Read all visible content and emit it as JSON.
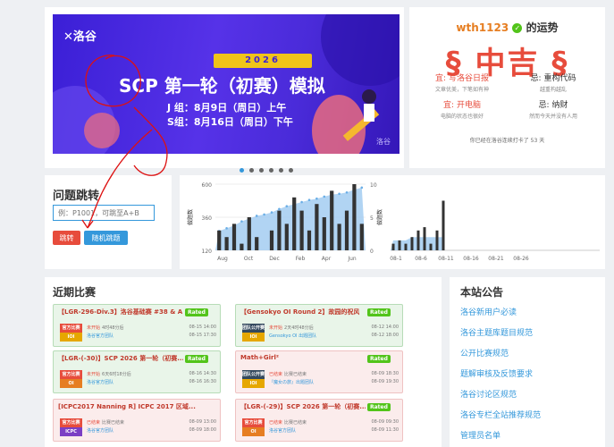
{
  "banner": {
    "logo": "洛谷",
    "year": "2026",
    "title": "SCP 第一轮（初赛）模拟",
    "line_j": "J 组：8月9日（周日）上午",
    "line_s": "S组：8月16日（周日）下午",
    "corner": "洛谷",
    "slide_count": 6,
    "active_slide": 0
  },
  "fortune": {
    "username": "wth1123",
    "suffix": "的运势",
    "result": "§ 中吉 §",
    "good_label": "宜:",
    "bad_label": "忌:",
    "good": [
      {
        "text": "写洛谷日报",
        "sub": "文章优美，下笔如有神"
      },
      {
        "text": "开电脑",
        "sub": "电脑的状态也很好"
      }
    ],
    "bad": [
      {
        "text": "重构代码",
        "sub": "越重构越乱"
      },
      {
        "text": "纳财",
        "sub": "然而今天并没有人用"
      }
    ],
    "footer": "你已经在洛谷连续打卡了 53 天"
  },
  "jump": {
    "title": "问题跳转",
    "placeholder": "例：P1001，可跳至A+B",
    "jump_label": "跳转",
    "random_label": "随机跳题"
  },
  "chart_data": [
    {
      "type": "bar",
      "ylabel": "做题数",
      "y2label": "做题数",
      "yticks": [
        120,
        360,
        600
      ],
      "y2ticks": [
        0,
        5,
        10
      ],
      "xticks": [
        "Aug",
        "Oct",
        "Dec",
        "Feb",
        "Apr",
        "Jun"
      ],
      "area": [
        260,
        280,
        300,
        330,
        350,
        370,
        380,
        395,
        420,
        440,
        455,
        470,
        485,
        495,
        510,
        525,
        530,
        540,
        560,
        575
      ],
      "bars": [
        3,
        2,
        4,
        1,
        5,
        2,
        0,
        3,
        6,
        4,
        8,
        6,
        3,
        7,
        5,
        9,
        4,
        6,
        10,
        4
      ]
    },
    {
      "type": "bar",
      "xticks": [
        "08-1",
        "08-6",
        "08-11",
        "08-16",
        "08-21",
        "08-26"
      ],
      "area": [
        1.5,
        1.5,
        1.5,
        2,
        2,
        2,
        2,
        2,
        2
      ],
      "bars": [
        1,
        1.5,
        1,
        2,
        3,
        3.5,
        1,
        3,
        7.5
      ]
    }
  ],
  "contests": {
    "title": "近期比赛",
    "items": [
      {
        "name": "【LGR-296-Div.3】洛谷基础赛 #38 & A...",
        "rated": "Rated",
        "type": "官方比赛",
        "rule": "IOI",
        "status": "未开始",
        "status_detail": "4时48分后",
        "host": "洛谷官方团队",
        "start": "08-15 14:00",
        "end": "08-15 17:30",
        "color": "green",
        "type_color": "red",
        "rule_color": "yellow"
      },
      {
        "name": "【Gensokyo OI Round 2】故园的祝风",
        "rated": "Rated",
        "type": "团队公开赛",
        "rule": "IOI",
        "status": "未开始",
        "status_detail": "2天4时48分后",
        "host": "Gensokyo OI 出题团队",
        "start": "08-12 14:00",
        "end": "08-12 18:00",
        "color": "green",
        "type_color": "dark",
        "rule_color": "yellow"
      },
      {
        "name": "【LGR-(-30)】SCP 2026 第一轮（初赛...",
        "rated": "Rated",
        "type": "官方比赛",
        "rule": "OI",
        "status": "未开始",
        "status_detail": "6天6时18分后",
        "host": "洛谷官方团队",
        "start": "08-16 14:30",
        "end": "08-16 16:30",
        "color": "green",
        "type_color": "red",
        "rule_color": "orange"
      },
      {
        "name": "Math+Girl²",
        "rated": "Rated",
        "type": "团队公开赛",
        "rule": "IOI",
        "status": "已结束",
        "status_detail": "比赛已结束",
        "host": "『魔女の旅』出题团队",
        "start": "08-09 18:30",
        "end": "08-09 19:30",
        "color": "red",
        "type_color": "dark",
        "rule_color": "yellow"
      },
      {
        "name": "[ICPC2017 Nanning R] ICPC 2017 区域...",
        "rated": "",
        "type": "官方比赛",
        "rule": "ICPC",
        "status": "已结束",
        "status_detail": "比赛已结束",
        "host": "洛谷官方团队",
        "start": "08-09 13:00",
        "end": "08-09 18:00",
        "color": "red",
        "type_color": "red",
        "rule_color": "purple"
      },
      {
        "name": "【LGR-(-29)】SCP 2026 第一轮（初赛...",
        "rated": "Rated",
        "type": "官方比赛",
        "rule": "OI",
        "status": "已结束",
        "status_detail": "比赛已结束",
        "host": "洛谷官方团队",
        "start": "08-09 09:30",
        "end": "08-09 11:30",
        "color": "red",
        "type_color": "red",
        "rule_color": "orange"
      }
    ]
  },
  "notices": {
    "title": "本站公告",
    "items": [
      "洛谷新用户必读",
      "洛谷主题库题目规范",
      "公开比赛规范",
      "题解审核及反馈要求",
      "洛谷讨论区规范",
      "洛谷专栏全站推荐规范",
      "管理员名单"
    ]
  },
  "colors": {
    "accent": "#3498db",
    "danger": "#e74c3c",
    "rated": "#52c41a",
    "banner": "#4a2bd9"
  }
}
